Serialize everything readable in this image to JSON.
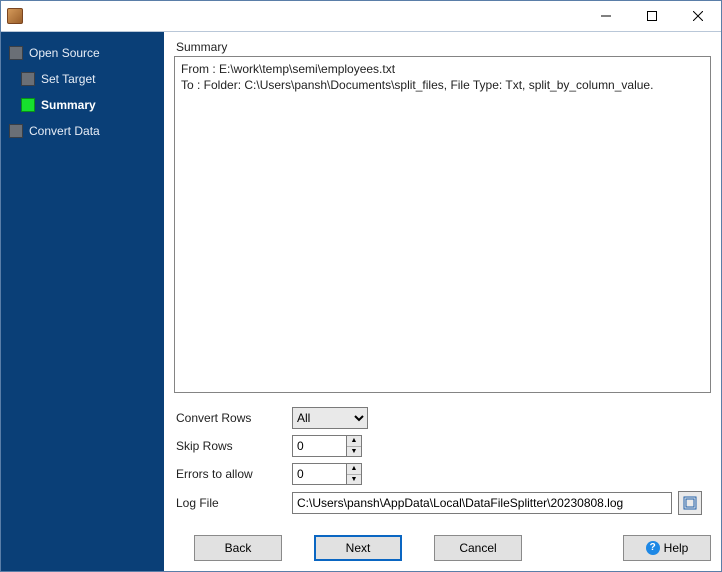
{
  "titlebar": {
    "title": ""
  },
  "sidebar": {
    "steps": [
      {
        "label": "Open Source",
        "depth": 0,
        "current": false
      },
      {
        "label": "Set Target",
        "depth": 1,
        "current": false
      },
      {
        "label": "Summary",
        "depth": 1,
        "current": true
      },
      {
        "label": "Convert Data",
        "depth": 0,
        "current": false
      }
    ]
  },
  "summary": {
    "heading": "Summary",
    "line_from": "From : E:\\work\\temp\\semi\\employees.txt",
    "line_to": "To : Folder: C:\\Users\\pansh\\Documents\\split_files, File Type: Txt, split_by_column_value."
  },
  "form": {
    "convert_rows": {
      "label": "Convert Rows",
      "value": "All"
    },
    "skip_rows": {
      "label": "Skip Rows",
      "value": "0"
    },
    "errors": {
      "label": "Errors to allow",
      "value": "0"
    },
    "log_file": {
      "label": "Log File",
      "value": "C:\\Users\\pansh\\AppData\\Local\\DataFileSplitter\\20230808.log"
    }
  },
  "buttons": {
    "back": "Back",
    "next": "Next",
    "cancel": "Cancel",
    "help": "Help"
  }
}
